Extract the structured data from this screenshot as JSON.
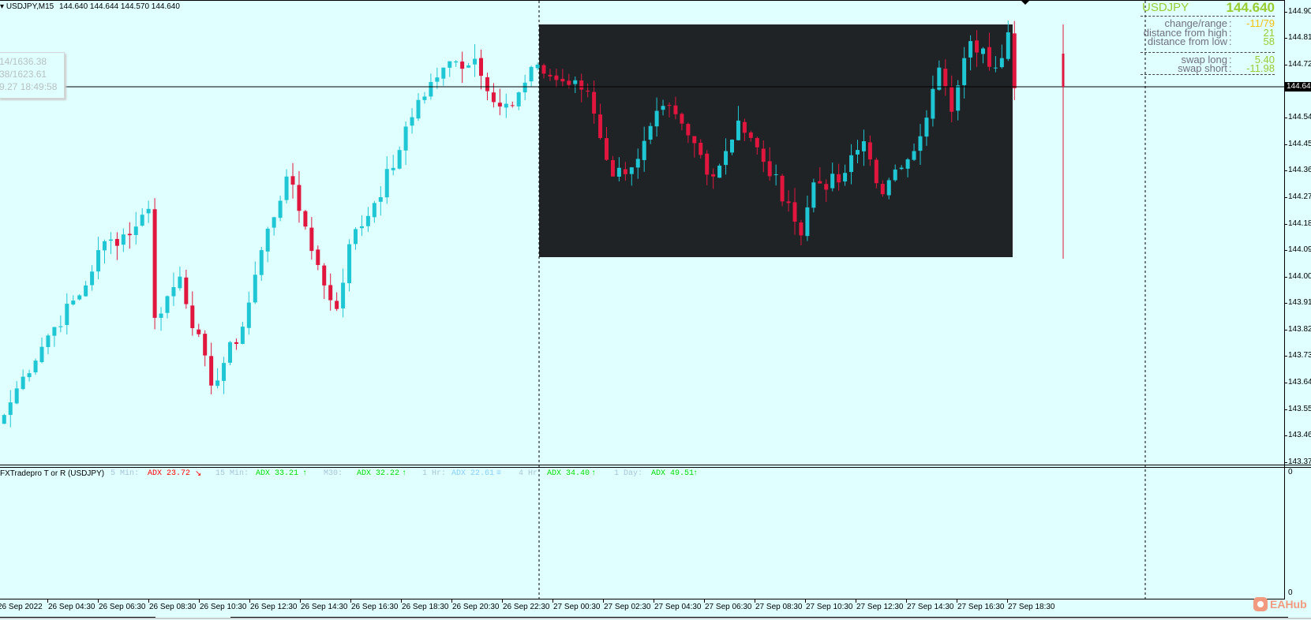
{
  "header": {
    "symbol_tf": "USDJPY,M15",
    "ohlc": "144.640 144.644 144.570 144.640"
  },
  "tooltip": {
    "lines": [
      "14/1636.38",
      "38/1623.61",
      "9.27 18:49:58"
    ]
  },
  "info_panel": {
    "symbol": "USDJPY",
    "price": "144.640",
    "rows": [
      {
        "label": "change/range",
        "value": "-11/79"
      },
      {
        "label": "distance from high",
        "value": "21"
      },
      {
        "label": "distance from low",
        "value": "58"
      },
      {
        "label": "swap long",
        "value": "5.40"
      },
      {
        "label": "swap short",
        "value": "-11.98"
      }
    ],
    "colon": ":"
  },
  "price_axis": {
    "labels": [
      "144.900",
      "144.810",
      "144.720",
      "144.540",
      "144.450",
      "144.360",
      "144.270",
      "144.180",
      "144.090",
      "144.000",
      "143.910",
      "143.820",
      "143.730",
      "143.640",
      "143.550",
      "143.460",
      "143.370"
    ],
    "current": "144.640",
    "sub_zero": "0"
  },
  "indicator": {
    "name": "FXTradepro T or R (USDJPY)",
    "items": [
      {
        "tf": "5 Min:",
        "adx": "ADX 23.72",
        "arrow": "↘",
        "color": "#ff0000"
      },
      {
        "tf": "15 Min:",
        "adx": "ADX 33.21",
        "arrow": "↑",
        "color": "#00dd00"
      },
      {
        "tf": "M30:",
        "adx": "ADX 32.22",
        "arrow": "↑",
        "color": "#00dd00"
      },
      {
        "tf": "1 Hr:",
        "adx": "ADX 22.61",
        "arrow": "≡",
        "color": "#87cefa"
      },
      {
        "tf": "4 Hr",
        "adx": "ADX 34.40",
        "arrow": "↑",
        "color": "#00dd00"
      },
      {
        "tf": "1 Day:",
        "adx": "ADX 49.51",
        "arrow": "↑",
        "color": "#00dd00"
      }
    ]
  },
  "time_axis": [
    "26 Sep 2022",
    "26 Sep 04:30",
    "26 Sep 06:30",
    "26 Sep 08:30",
    "26 Sep 10:30",
    "26 Sep 12:30",
    "26 Sep 14:30",
    "26 Sep 16:30",
    "26 Sep 18:30",
    "26 Sep 20:30",
    "26 Sep 22:30",
    "27 Sep 00:30",
    "27 Sep 02:30",
    "27 Sep 04:30",
    "27 Sep 06:30",
    "27 Sep 08:30",
    "27 Sep 10:30",
    "27 Sep 12:30",
    "27 Sep 14:30",
    "27 Sep 16:30",
    "27 Sep 18:30"
  ],
  "watermark": "EAHub",
  "colors": {
    "bull": "#1fc7d4",
    "bear": "#e0163e",
    "background": "#e0ffff",
    "box": "#1f2326"
  },
  "price_path": [
    [
      0,
      143.53
    ],
    [
      3,
      143.66
    ],
    [
      7,
      143.8
    ],
    [
      13,
      143.97
    ],
    [
      15,
      144.09
    ],
    [
      21,
      144.17
    ],
    [
      23,
      144.23
    ],
    [
      24,
      143.86
    ],
    [
      28,
      144.0
    ],
    [
      33,
      143.63
    ],
    [
      38,
      143.83
    ],
    [
      41,
      144.09
    ],
    [
      45,
      144.34
    ],
    [
      48,
      144.17
    ],
    [
      51,
      143.97
    ],
    [
      53,
      143.89
    ],
    [
      55,
      144.11
    ],
    [
      59,
      144.25
    ],
    [
      63,
      144.43
    ],
    [
      66,
      144.6
    ],
    [
      70,
      144.71
    ],
    [
      75,
      144.74
    ],
    [
      77,
      144.63
    ],
    [
      81,
      144.58
    ],
    [
      85,
      144.72
    ],
    [
      87,
      144.68
    ],
    [
      93,
      144.63
    ],
    [
      97,
      144.34
    ],
    [
      101,
      144.4
    ],
    [
      105,
      144.58
    ],
    [
      109,
      144.48
    ],
    [
      113,
      144.34
    ],
    [
      117,
      144.53
    ],
    [
      121,
      144.39
    ],
    [
      125,
      144.25
    ],
    [
      127,
      144.14
    ],
    [
      129,
      144.32
    ],
    [
      133,
      144.32
    ],
    [
      137,
      144.46
    ],
    [
      140,
      144.28
    ],
    [
      143,
      144.37
    ],
    [
      147,
      144.54
    ],
    [
      149,
      144.71
    ],
    [
      151,
      144.56
    ],
    [
      154,
      144.8
    ],
    [
      158,
      144.71
    ],
    [
      160,
      144.83
    ],
    [
      161,
      144.64
    ]
  ]
}
